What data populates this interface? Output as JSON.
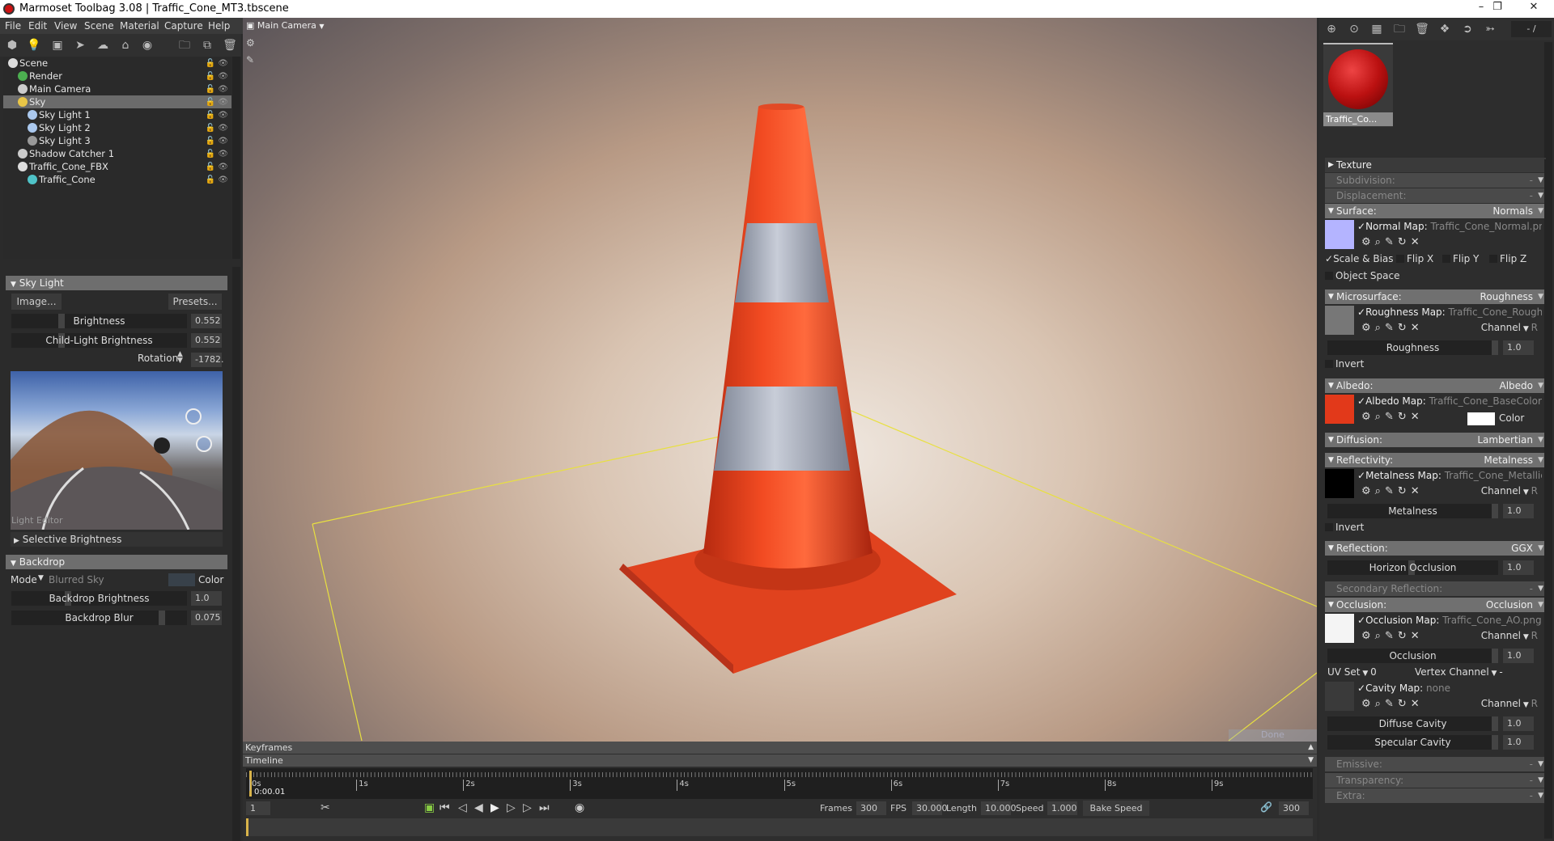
{
  "window": {
    "title": "Marmoset Toolbag 3.08  |  Traffic_Cone_MT3.tbscene"
  },
  "menu": [
    "File",
    "Edit",
    "View",
    "Scene",
    "Material",
    "Capture",
    "Help"
  ],
  "scene_tree": [
    {
      "label": "Scene",
      "depth": 0,
      "icon": "scene-icon",
      "color": "#ddd"
    },
    {
      "label": "Render",
      "depth": 1,
      "icon": "render-gear-icon",
      "color": "#4caf50"
    },
    {
      "label": "Main Camera",
      "depth": 1,
      "icon": "camera-icon",
      "color": "#ccc"
    },
    {
      "label": "Sky",
      "depth": 1,
      "icon": "sky-icon",
      "color": "#e8c547",
      "selected": true
    },
    {
      "label": "Sky Light 1",
      "depth": 2,
      "icon": "light-bulb-icon",
      "color": "#aac8ee"
    },
    {
      "label": "Sky Light 2",
      "depth": 2,
      "icon": "light-bulb-icon",
      "color": "#aac8ee"
    },
    {
      "label": "Sky Light 3",
      "depth": 2,
      "icon": "light-bulb-icon",
      "color": "#999"
    },
    {
      "label": "Shadow Catcher 1",
      "depth": 1,
      "icon": "shadow-catcher-icon",
      "color": "#ccc"
    },
    {
      "label": "Traffic_Cone_FBX",
      "depth": 1,
      "icon": "mesh-file-icon",
      "color": "#ddd"
    },
    {
      "label": "Traffic_Cone",
      "depth": 2,
      "icon": "mesh-cube-icon",
      "color": "#4fc3c8"
    }
  ],
  "sky_light": {
    "title": "Sky Light",
    "image_btn": "Image...",
    "presets_btn": "Presets...",
    "brightness_label": "Brightness",
    "brightness": "0.552",
    "child_label": "Child-Light Brightness",
    "child": "0.552",
    "rotation_label": "Rotation",
    "rotation": "-1782.",
    "light_editor": "Light Editor",
    "selective": "Selective Brightness"
  },
  "backdrop": {
    "title": "Backdrop",
    "mode_label": "Mode",
    "mode": "Blurred Sky",
    "color_label": "Color",
    "brightness_label": "Backdrop Brightness",
    "brightness": "1.0",
    "blur_label": "Backdrop Blur",
    "blur": "0.075"
  },
  "viewport": {
    "camera": "Main Camera",
    "done": "Done"
  },
  "timeline": {
    "keyframes": "Keyframes",
    "timeline": "Timeline",
    "current_time": "0:00.01",
    "ticks": [
      "0s",
      "1s",
      "2s",
      "3s",
      "4s",
      "5s",
      "6s",
      "7s",
      "8s",
      "9s"
    ],
    "frame": "1",
    "frames_label": "Frames",
    "frames": "300",
    "fps_label": "FPS",
    "fps": "30.000",
    "length_label": "Length",
    "length": "10.000",
    "speed_label": "Speed",
    "speed": "1.000",
    "bake_speed": "Bake Speed",
    "end_frame": "300"
  },
  "material": {
    "name": "Traffic_Co...",
    "counter": "- /"
  },
  "props": [
    {
      "type": "hdr",
      "label": "Texture",
      "collapsed": true,
      "plain": true
    },
    {
      "type": "hdr",
      "label": "Subdivision:",
      "value": "-",
      "dim": true
    },
    {
      "type": "hdr",
      "label": "Displacement:",
      "value": "-",
      "dim": true
    },
    {
      "type": "hdr",
      "label": "Surface:",
      "value": "Normals"
    },
    {
      "type": "map",
      "label": "Normal Map:",
      "file": "Traffic_Cone_Normal.png",
      "thumb": "#b4b4ff"
    },
    {
      "type": "checks",
      "items": [
        "Scale & Bias",
        "Flip X",
        "Flip Y",
        "Flip Z"
      ]
    },
    {
      "type": "checks",
      "items": [
        "Object Space"
      ]
    },
    {
      "type": "hdr",
      "label": "Microsurface:",
      "value": "Roughness"
    },
    {
      "type": "map",
      "label": "Roughness Map:",
      "file": "Traffic_Cone_Roughness",
      "thumb": "#777",
      "channel": "Channel",
      "ch": "R"
    },
    {
      "type": "slider",
      "label": "Roughness",
      "value": "1.0"
    },
    {
      "type": "checks",
      "items": [
        "Invert"
      ]
    },
    {
      "type": "hdr",
      "label": "Albedo:",
      "value": "Albedo"
    },
    {
      "type": "map",
      "label": "Albedo Map:",
      "file": "Traffic_Cone_BaseColor.png",
      "thumb": "#e2391a",
      "color_label": "Color"
    },
    {
      "type": "hdr",
      "label": "Diffusion:",
      "value": "Lambertian"
    },
    {
      "type": "hdr",
      "label": "Reflectivity:",
      "value": "Metalness"
    },
    {
      "type": "map",
      "label": "Metalness Map:",
      "file": "Traffic_Cone_Metallic.png",
      "thumb": "#000",
      "channel": "Channel",
      "ch": "R"
    },
    {
      "type": "slider",
      "label": "Metalness",
      "value": "1.0"
    },
    {
      "type": "checks",
      "items": [
        "Invert"
      ]
    },
    {
      "type": "hdr",
      "label": "Reflection:",
      "value": "GGX"
    },
    {
      "type": "slider",
      "label": "Horizon Occlusion",
      "value": "1.0"
    },
    {
      "type": "hdr",
      "label": "Secondary Reflection:",
      "value": "-",
      "dim": true
    },
    {
      "type": "hdr",
      "label": "Occlusion:",
      "value": "Occlusion"
    },
    {
      "type": "map",
      "label": "Occlusion Map:",
      "file": "Traffic_Cone_AO.png",
      "thumb": "#f4f4f4",
      "channel": "Channel",
      "ch": "R"
    },
    {
      "type": "slider",
      "label": "Occlusion",
      "value": "1.0"
    },
    {
      "type": "uvset",
      "uv_label": "UV Set",
      "uv": "0",
      "vc_label": "Vertex Channel",
      "vc": "-"
    },
    {
      "type": "map",
      "label": "Cavity Map:",
      "file": "none",
      "thumb": "#3a3a3a",
      "channel": "Channel",
      "ch": "R"
    },
    {
      "type": "slider",
      "label": "Diffuse Cavity",
      "value": "1.0"
    },
    {
      "type": "slider",
      "label": "Specular Cavity",
      "value": "1.0"
    },
    {
      "type": "hdr",
      "label": "Emissive:",
      "value": "-",
      "dim": true
    },
    {
      "type": "hdr",
      "label": "Transparency:",
      "value": "-",
      "dim": true
    },
    {
      "type": "hdr",
      "label": "Extra:",
      "value": "-",
      "dim": true
    }
  ]
}
